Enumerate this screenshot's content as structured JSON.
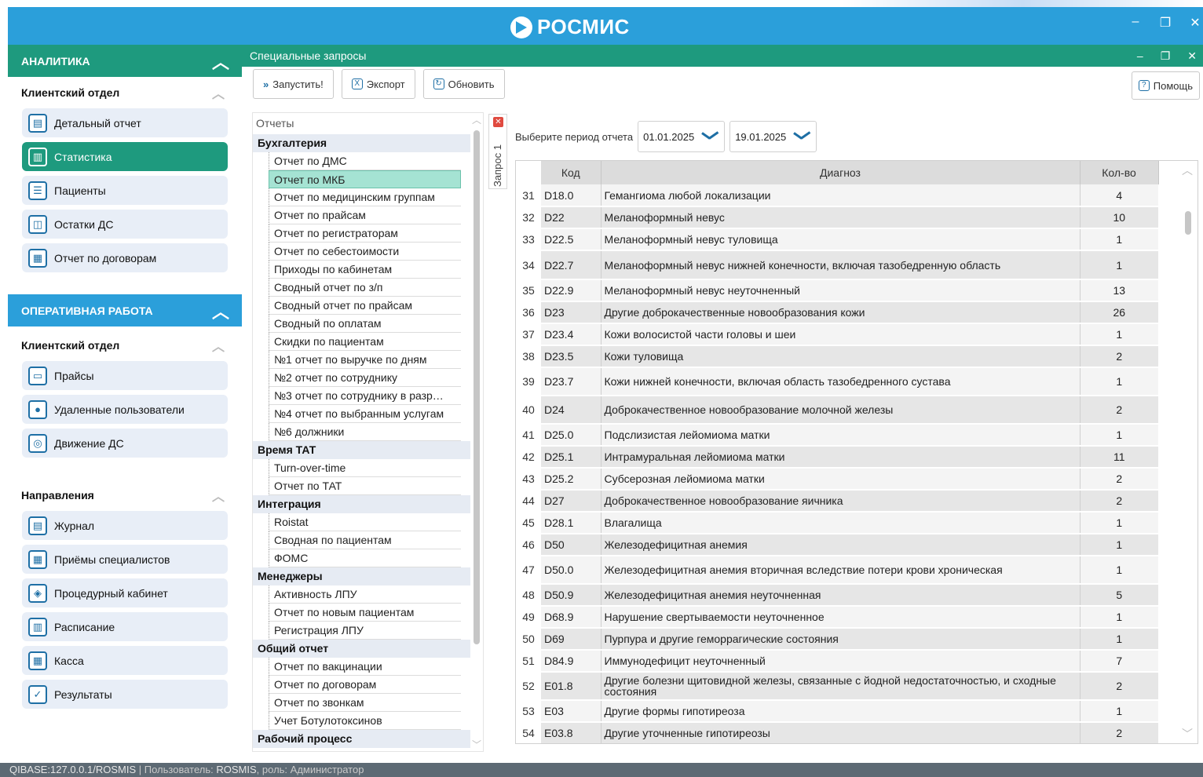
{
  "app": {
    "brand": "РОСМИС"
  },
  "window_controls": {
    "minimize": "–",
    "restore": "❐",
    "close": "✕"
  },
  "sidebar": {
    "analytics_header": "АНАЛИТИКА",
    "analytics_sub": "Клиентский отдел",
    "analytics_items": [
      {
        "label": "Детальный отчет",
        "icon": "report-table-icon"
      },
      {
        "label": "Статистика",
        "icon": "statistics-chart-icon",
        "active": true
      },
      {
        "label": "Пациенты",
        "icon": "patients-card-icon"
      },
      {
        "label": "Остатки ДС",
        "icon": "wallet-icon"
      },
      {
        "label": "Отчет по договорам",
        "icon": "contracts-icon"
      }
    ],
    "ops_header": "ОПЕРАТИВНАЯ РАБОТА",
    "ops_sub": "Клиентский отдел",
    "ops_items": [
      {
        "label": "Прайсы",
        "icon": "price-box-icon"
      },
      {
        "label": "Удаленные пользователи",
        "icon": "remote-user-icon"
      },
      {
        "label": "Движение ДС",
        "icon": "money-flow-icon"
      }
    ],
    "dir_sub": "Направления",
    "dir_items": [
      {
        "label": "Журнал",
        "icon": "journal-book-icon"
      },
      {
        "label": "Приёмы специалистов",
        "icon": "specialists-icon"
      },
      {
        "label": "Процедурный кабинет",
        "icon": "procedure-room-icon"
      },
      {
        "label": "Расписание",
        "icon": "schedule-icon"
      },
      {
        "label": "Касса",
        "icon": "cash-register-icon"
      },
      {
        "label": "Результаты",
        "icon": "results-icon"
      }
    ]
  },
  "main": {
    "title": "Специальные запросы",
    "toolbar": {
      "run": "Запустить!",
      "export": "Экспорт",
      "refresh": "Обновить",
      "help": "Помощь"
    },
    "tab_label": "Запрос 1",
    "period": {
      "label": "Выберите период отчета",
      "from": "01.01.2025",
      "to": "19.01.2025"
    }
  },
  "tree": {
    "title": "Отчеты",
    "groups": [
      {
        "name": "Бухгалтерия",
        "items": [
          "Отчет по ДМС",
          "Отчет по МКБ",
          "Отчет по медицинским группам",
          "Отчет по прайсам",
          "Отчет по регистраторам",
          "Отчет по себестоимости",
          "Приходы по кабинетам",
          "Сводный отчет по  з/п",
          "Сводный отчет по прайсам",
          "Сводный по оплатам",
          "Скидки по пациентам",
          "№1 отчет по выручке по дням",
          "№2 отчет по сотруднику",
          "№3 отчет по сотруднику в разр…",
          "№4 отчет по выбранным услугам",
          "№6 должники"
        ]
      },
      {
        "name": "Время ТАТ",
        "items": [
          "Turn-over-time",
          "Отчет по ТАТ"
        ]
      },
      {
        "name": "Интеграция",
        "items": [
          "Roistat",
          "Сводная по пациентам",
          "ФОМС"
        ]
      },
      {
        "name": "Менеджеры",
        "items": [
          "Активность ЛПУ",
          "Отчет по новым пациентам",
          "Регистрация ЛПУ"
        ]
      },
      {
        "name": "Общий отчет",
        "items": [
          "Отчет по вакцинации",
          "Отчет по договорам",
          "Отчет по звонкам",
          "Учет Ботулотоксинов"
        ]
      },
      {
        "name": "Рабочий процесс",
        "items": []
      }
    ],
    "selected": "Отчет по МКБ"
  },
  "table": {
    "headers": [
      "Код",
      "Диагноз",
      "Кол-во"
    ],
    "rows": [
      {
        "n": "31",
        "code": "D18.0",
        "diag": "Гемангиома любой локализации",
        "qty": "4"
      },
      {
        "n": "32",
        "code": "D22",
        "diag": "Меланоформный невус",
        "qty": "10"
      },
      {
        "n": "33",
        "code": "D22.5",
        "diag": "Меланоформный невус туловища",
        "qty": "1"
      },
      {
        "n": "34",
        "code": "D22.7",
        "diag": "Меланоформный невус нижней конечности, включая тазобедренную область",
        "qty": "1"
      },
      {
        "n": "35",
        "code": "D22.9",
        "diag": "Меланоформный невус неуточненный",
        "qty": "13"
      },
      {
        "n": "36",
        "code": "D23",
        "diag": "Другие доброкачественные новообразования кожи",
        "qty": "26"
      },
      {
        "n": "37",
        "code": "D23.4",
        "diag": "Кожи волосистой части головы и шеи",
        "qty": "1"
      },
      {
        "n": "38",
        "code": "D23.5",
        "diag": "Кожи туловища",
        "qty": "2"
      },
      {
        "n": "39",
        "code": "D23.7",
        "diag": "Кожи нижней конечности, включая область тазобедренного сустава",
        "qty": "1"
      },
      {
        "n": "40",
        "code": "D24",
        "diag": "Доброкачественное новообразование молочной железы",
        "qty": "2"
      },
      {
        "n": "41",
        "code": "D25.0",
        "diag": "Подслизистая лейомиома матки",
        "qty": "1"
      },
      {
        "n": "42",
        "code": "D25.1",
        "diag": "Интрамуральная лейомиома матки",
        "qty": "11"
      },
      {
        "n": "43",
        "code": "D25.2",
        "diag": "Субсерозная лейомиома матки",
        "qty": "2"
      },
      {
        "n": "44",
        "code": "D27",
        "diag": "Доброкачественное новообразование яичника",
        "qty": "2"
      },
      {
        "n": "45",
        "code": "D28.1",
        "diag": "Влагалища",
        "qty": "1"
      },
      {
        "n": "46",
        "code": "D50",
        "diag": "Железодефицитная анемия",
        "qty": "1"
      },
      {
        "n": "47",
        "code": "D50.0",
        "diag": "Железодефицитная анемия вторичная вследствие потери крови  хроническая",
        "qty": "1"
      },
      {
        "n": "48",
        "code": "D50.9",
        "diag": "Железодефицитная анемия неуточненная",
        "qty": "5"
      },
      {
        "n": "49",
        "code": "D68.9",
        "diag": "Нарушение свертываемости неуточненное",
        "qty": "1"
      },
      {
        "n": "50",
        "code": "D69",
        "diag": "Пурпура и другие геморрагические состояния",
        "qty": "1"
      },
      {
        "n": "51",
        "code": "D84.9",
        "diag": "Иммунодефицит неуточненный",
        "qty": "7"
      },
      {
        "n": "52",
        "code": "E01.8",
        "diag": "Другие болезни щитовидной железы, связанные с йодной недостаточностью, и сходные состояния",
        "qty": "2"
      },
      {
        "n": "53",
        "code": "E03",
        "diag": "Другие формы гипотиреоза",
        "qty": "1"
      },
      {
        "n": "54",
        "code": "E03.8",
        "diag": "Другие уточненные гипотиреозы",
        "qty": "2"
      }
    ]
  },
  "statusbar": {
    "db": "QIBASE:127.0.0.1/ROSMIS",
    "user_label": "Пользователь:",
    "user": "ROSMIS",
    "role": ", роль: Администратор"
  },
  "colors": {
    "blue": "#2b9fda",
    "green": "#1e9a7e",
    "selected": "#a5e3d3"
  }
}
